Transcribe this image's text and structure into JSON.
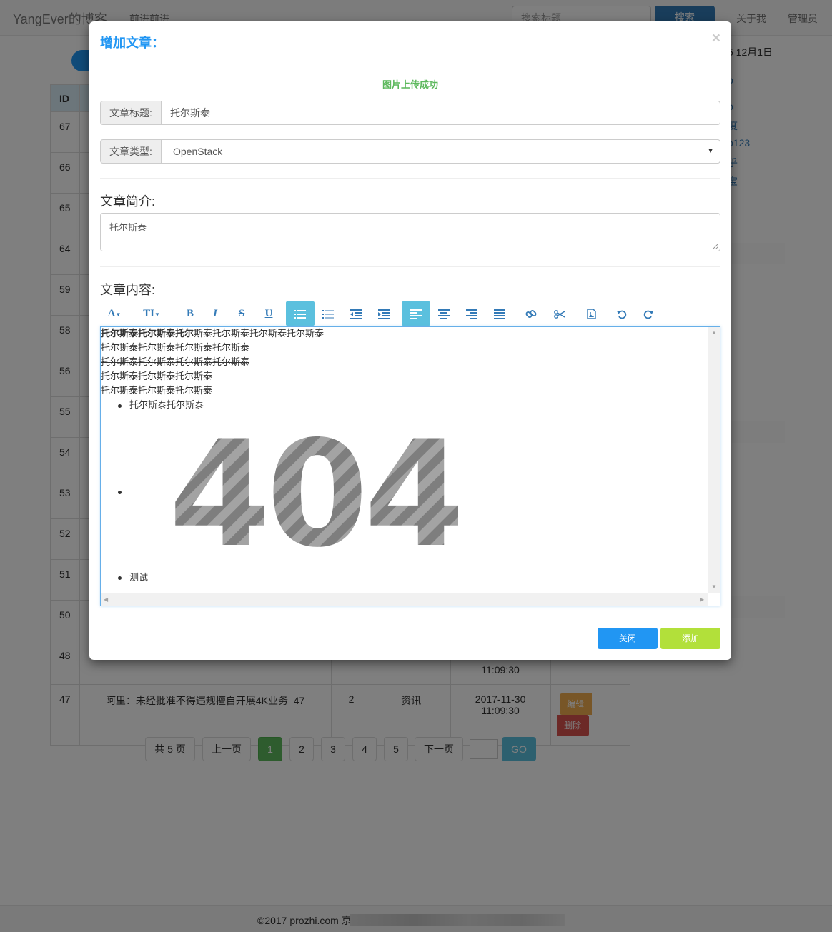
{
  "navbar": {
    "brand": "YangEver的博客",
    "slogan": "前进前进..",
    "search_placeholder": "搜索标题",
    "search_button": "搜索",
    "about": "关于我",
    "admin": "管理员"
  },
  "table": {
    "header_id": "ID",
    "row_ids": [
      "67",
      "66",
      "65",
      "64",
      "59",
      "58",
      "56",
      "55",
      "54",
      "53",
      "52",
      "51",
      "50"
    ],
    "last_row_ids": [
      "48"
    ],
    "row_48_time": "11:09:30",
    "row_47": {
      "id": "47",
      "title": "阿里：未经批准不得违规擅自开展4K业务_47",
      "count": "2",
      "type": "资讯",
      "date": "2017-11-30",
      "time": "11:09:30",
      "edit": "编辑",
      "delete": "删除"
    }
  },
  "sidebar": {
    "date": "5 12月1日",
    "links": [
      "b",
      "度",
      "o123",
      "乎",
      "宝"
    ]
  },
  "pagination": {
    "total": "共 5 页",
    "prev": "上一页",
    "pages": [
      "1",
      "2",
      "3",
      "4",
      "5"
    ],
    "current": "1",
    "next": "下一页",
    "go": "GO"
  },
  "footer": {
    "copyright": "©2017 prozhi.com 京"
  },
  "modal": {
    "title": "增加文章：",
    "close_symbol": "×",
    "upload_message": "图片上传成功",
    "title_label": "文章标题:",
    "title_value": "托尔斯泰",
    "type_label": "文章类型:",
    "type_value": "OpenStack",
    "summary_label": "文章简介:",
    "summary_value": "托尔斯泰",
    "content_label": "文章内容:",
    "toolbar": {
      "font": "A",
      "size": "TI",
      "bold": "B",
      "italic": "I",
      "strike": "S",
      "underline": "U"
    },
    "editor": {
      "line1_bold": "托尔斯泰托尔斯泰托尔",
      "line1_rest": "斯泰托尔斯泰托尔斯泰托尔斯泰",
      "line2": "托尔斯泰托尔斯泰托尔斯泰托尔斯泰",
      "line3": "托尔斯泰托尔斯泰托尔斯泰托尔斯泰",
      "line4": "托尔斯泰托尔斯泰托尔斯泰",
      "line5": "托尔斯泰托尔斯泰托尔斯泰",
      "list_item1": "托尔斯泰托尔斯泰",
      "image_text": "404",
      "list_item3": "测试"
    },
    "close_button": "关闭",
    "add_button": "添加"
  }
}
